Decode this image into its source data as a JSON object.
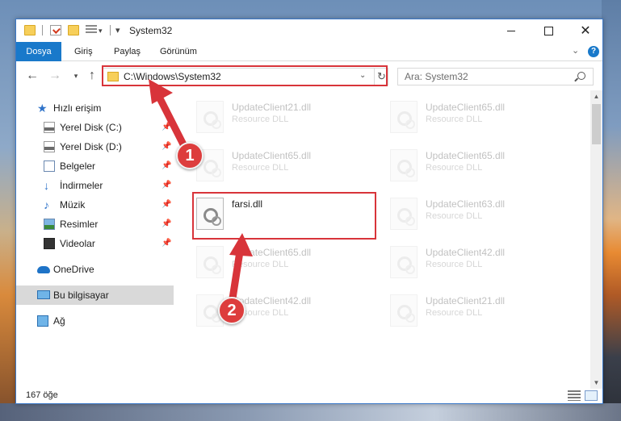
{
  "window": {
    "title": "System32",
    "controls": {
      "minimize_icon": "minimize-icon",
      "maximize_icon": "maximize-icon",
      "close": "✕"
    }
  },
  "ribbon": {
    "tabs": [
      "Dosya",
      "Giriş",
      "Paylaş",
      "Görünüm"
    ],
    "help": "?"
  },
  "navigation": {
    "address": "C:\\Windows\\System32",
    "search_placeholder": "Ara: System32"
  },
  "sidebar": {
    "items": [
      {
        "label": "Hızlı erişim",
        "icon": "star-icon"
      },
      {
        "label": "Yerel Disk (C:)",
        "icon": "disk-icon",
        "pinned": true
      },
      {
        "label": "Yerel Disk (D:)",
        "icon": "disk-icon",
        "pinned": true
      },
      {
        "label": "Belgeler",
        "icon": "documents-icon",
        "pinned": true
      },
      {
        "label": "İndirmeler",
        "icon": "download-icon",
        "pinned": true
      },
      {
        "label": "Müzik",
        "icon": "music-icon",
        "pinned": true
      },
      {
        "label": "Resimler",
        "icon": "pictures-icon",
        "pinned": true
      },
      {
        "label": "Videolar",
        "icon": "video-icon",
        "pinned": true
      },
      {
        "label": "OneDrive",
        "icon": "cloud-icon"
      },
      {
        "label": "Bu bilgisayar",
        "icon": "computer-icon",
        "selected": true
      },
      {
        "label": "Ağ",
        "icon": "network-icon"
      }
    ]
  },
  "files": [
    {
      "name": "UpdateClient21.dll",
      "type": "Resource DLL",
      "faded": true
    },
    {
      "name": "UpdateClient65.dll",
      "type": "Resource DLL",
      "faded": true
    },
    {
      "name": "UpdateClient65.dll",
      "type": "Resource DLL",
      "faded": true
    },
    {
      "name": "UpdateClient65.dll",
      "type": "Resource DLL",
      "faded": true
    },
    {
      "name": "farsi.dll",
      "type": "",
      "faded": false
    },
    {
      "name": "UpdateClient63.dll",
      "type": "Resource DLL",
      "faded": true
    },
    {
      "name": "UpdateClient65.dll",
      "type": "Resource DLL",
      "faded": true
    },
    {
      "name": "UpdateClient42.dll",
      "type": "Resource DLL",
      "faded": true
    },
    {
      "name": "UpdateClient42.dll",
      "type": "Resource DLL",
      "faded": true
    },
    {
      "name": "UpdateClient21.dll",
      "type": "Resource DLL",
      "faded": true
    }
  ],
  "status": {
    "item_count": "167 öğe"
  },
  "annotations": {
    "step1": "1",
    "step2": "2",
    "color": "#d8343a"
  }
}
